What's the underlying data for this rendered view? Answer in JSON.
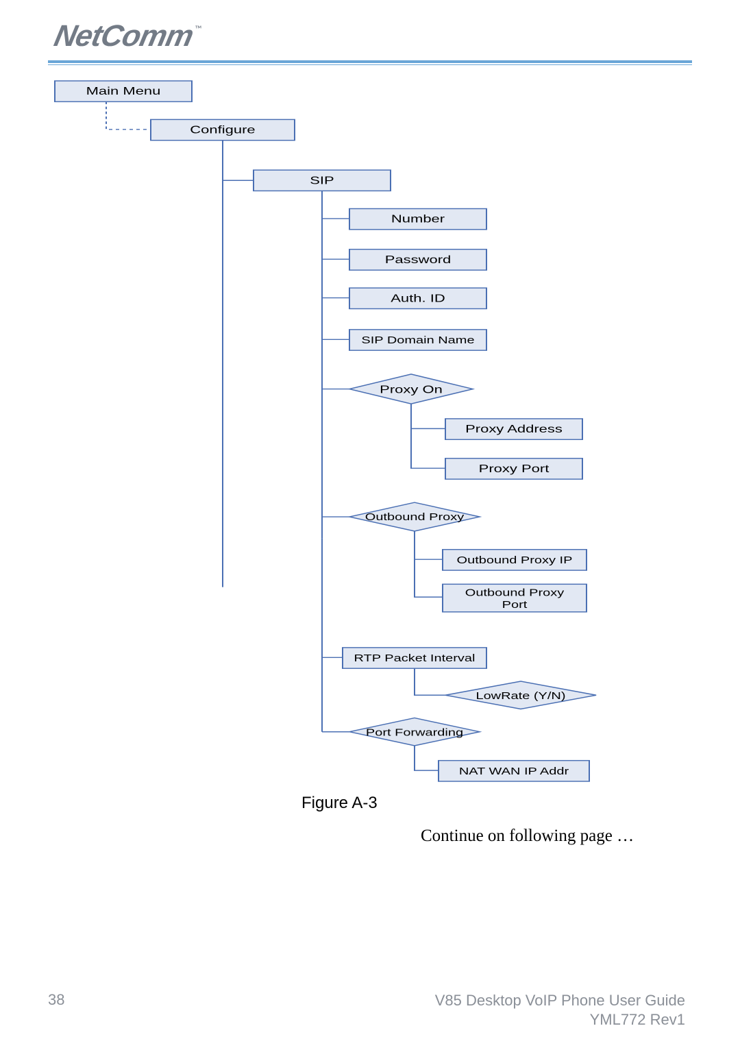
{
  "logo": {
    "brand": "NetComm",
    "tm": "™"
  },
  "diagram": {
    "main_menu": "Main Menu",
    "configure": "Configure",
    "sip": "SIP",
    "number": "Number",
    "password": "Password",
    "auth_id": "Auth. ID",
    "sip_domain": "SIP Domain Name",
    "proxy_on": "Proxy On",
    "proxy_addr": "Proxy Address",
    "proxy_port": "Proxy Port",
    "outbound_proxy": "Outbound Proxy",
    "outbound_proxy_ip": "Outbound Proxy IP",
    "outbound_proxy_port_l1": "Outbound Proxy",
    "outbound_proxy_port_l2": "Port",
    "rtp_packet_interval": "RTP Packet Interval",
    "lowrate": "LowRate (Y/N)",
    "port_forwarding": "Port Forwarding",
    "nat_wan": "NAT WAN IP Addr"
  },
  "caption": "Figure A-3",
  "continue": "Continue on following page …",
  "footer": {
    "page": "38",
    "title": "V85 Desktop VoIP Phone User Guide",
    "rev": "YML772 Rev1"
  }
}
